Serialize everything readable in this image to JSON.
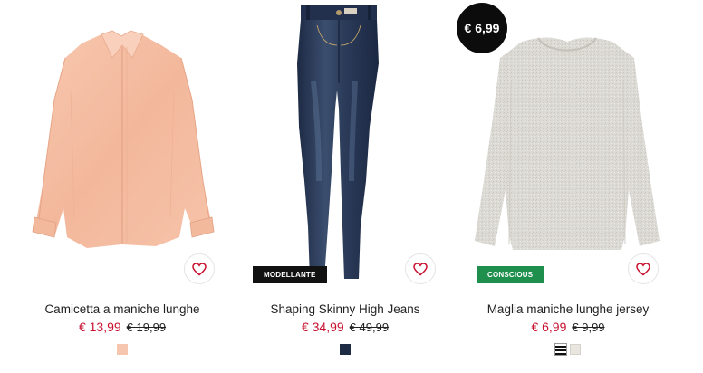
{
  "products": [
    {
      "name": "Camicetta a maniche lunghe",
      "price_sale": "€ 13,99",
      "price_old": "€ 19,99",
      "swatches": [
        "#f6c6ae"
      ]
    },
    {
      "name": "Shaping Skinny High Jeans",
      "price_sale": "€ 34,99",
      "price_old": "€ 49,99",
      "tag": "MODELLANTE",
      "swatches": [
        "#1d2b45"
      ]
    },
    {
      "name": "Maglia maniche lunghe jersey",
      "price_sale": "€ 6,99",
      "price_old": "€ 9,99",
      "tag": "CONSCIOUS",
      "badge": "€ 6,99",
      "swatches": [
        "striped-black-white",
        "#e9e6df"
      ]
    }
  ],
  "colors": {
    "sale_price": "#c8102e",
    "conscious_tag": "#1f8f4e",
    "modellante_tag": "#111111",
    "badge_bg": "#0c0c0c"
  },
  "icons": {
    "wishlist": "heart-outline-icon"
  }
}
